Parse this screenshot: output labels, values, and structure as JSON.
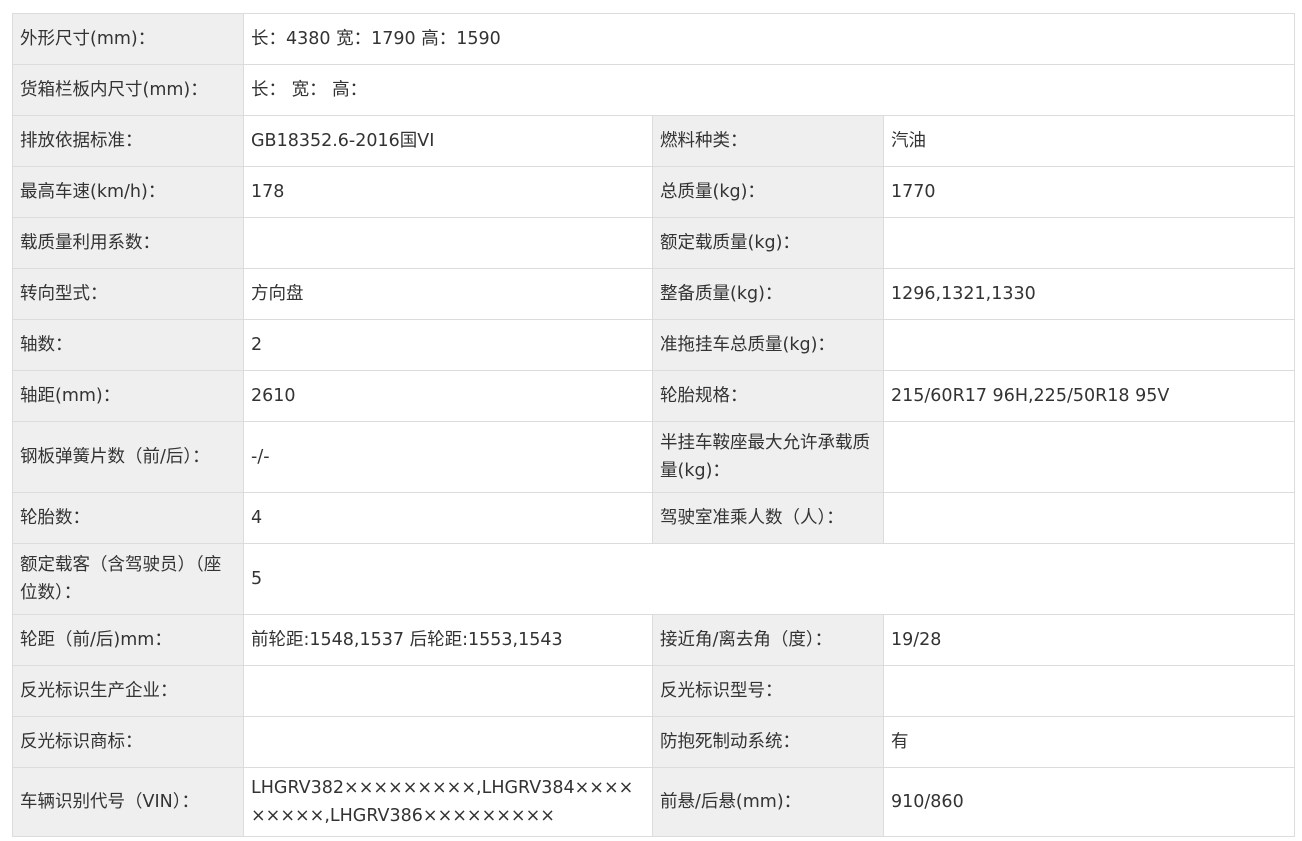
{
  "spec_table": {
    "rows": [
      {
        "type": "wide",
        "label": "外形尺寸(mm)：",
        "value": "长：4380 宽：1790 高：1590"
      },
      {
        "type": "wide",
        "label": "货箱栏板内尺寸(mm)：",
        "value": "长： 宽： 高："
      },
      {
        "type": "pair",
        "label1": "排放依据标准：",
        "value1": "GB18352.6-2016国VI",
        "label2": "燃料种类：",
        "value2": "汽油"
      },
      {
        "type": "pair",
        "label1": "最高车速(km/h)：",
        "value1": "178",
        "label2": "总质量(kg)：",
        "value2": "1770"
      },
      {
        "type": "pair",
        "label1": "载质量利用系数：",
        "value1": "",
        "label2": "额定载质量(kg)：",
        "value2": ""
      },
      {
        "type": "pair",
        "label1": "转向型式：",
        "value1": "方向盘",
        "label2": "整备质量(kg)：",
        "value2": "1296,1321,1330"
      },
      {
        "type": "pair",
        "label1": "轴数：",
        "value1": "2",
        "label2": "准拖挂车总质量(kg)：",
        "value2": ""
      },
      {
        "type": "pair",
        "label1": "轴距(mm)：",
        "value1": "2610",
        "label2": "轮胎规格：",
        "value2": "215/60R17 96H,225/50R18 95V"
      },
      {
        "type": "pair",
        "label1": "钢板弹簧片数（前/后）：",
        "value1": "-/-",
        "label2": "半挂车鞍座最大允许承载质量(kg)：",
        "value2": ""
      },
      {
        "type": "pair",
        "label1": "轮胎数：",
        "value1": "4",
        "label2": "驾驶室准乘人数（人）：",
        "value2": ""
      },
      {
        "type": "wide",
        "label": "额定载客（含驾驶员）（座位数）：",
        "value": "5"
      },
      {
        "type": "pair",
        "label1": "轮距（前/后)mm：",
        "value1": "前轮距:1548,1537 后轮距:1553,1543",
        "label2": "接近角/离去角（度）：",
        "value2": "19/28"
      },
      {
        "type": "pair",
        "label1": "反光标识生产企业：",
        "value1": "",
        "label2": "反光标识型号：",
        "value2": ""
      },
      {
        "type": "pair",
        "label1": "反光标识商标：",
        "value1": "",
        "label2": "防抱死制动系统：",
        "value2": "有"
      },
      {
        "type": "pair",
        "label1": "车辆识别代号（VIN）：",
        "value1": "LHGRV382×××××××××,LHGRV384×××××××××,LHGRV386×××××××××",
        "label2": "前悬/后悬(mm)：",
        "value2": "910/860"
      }
    ]
  }
}
